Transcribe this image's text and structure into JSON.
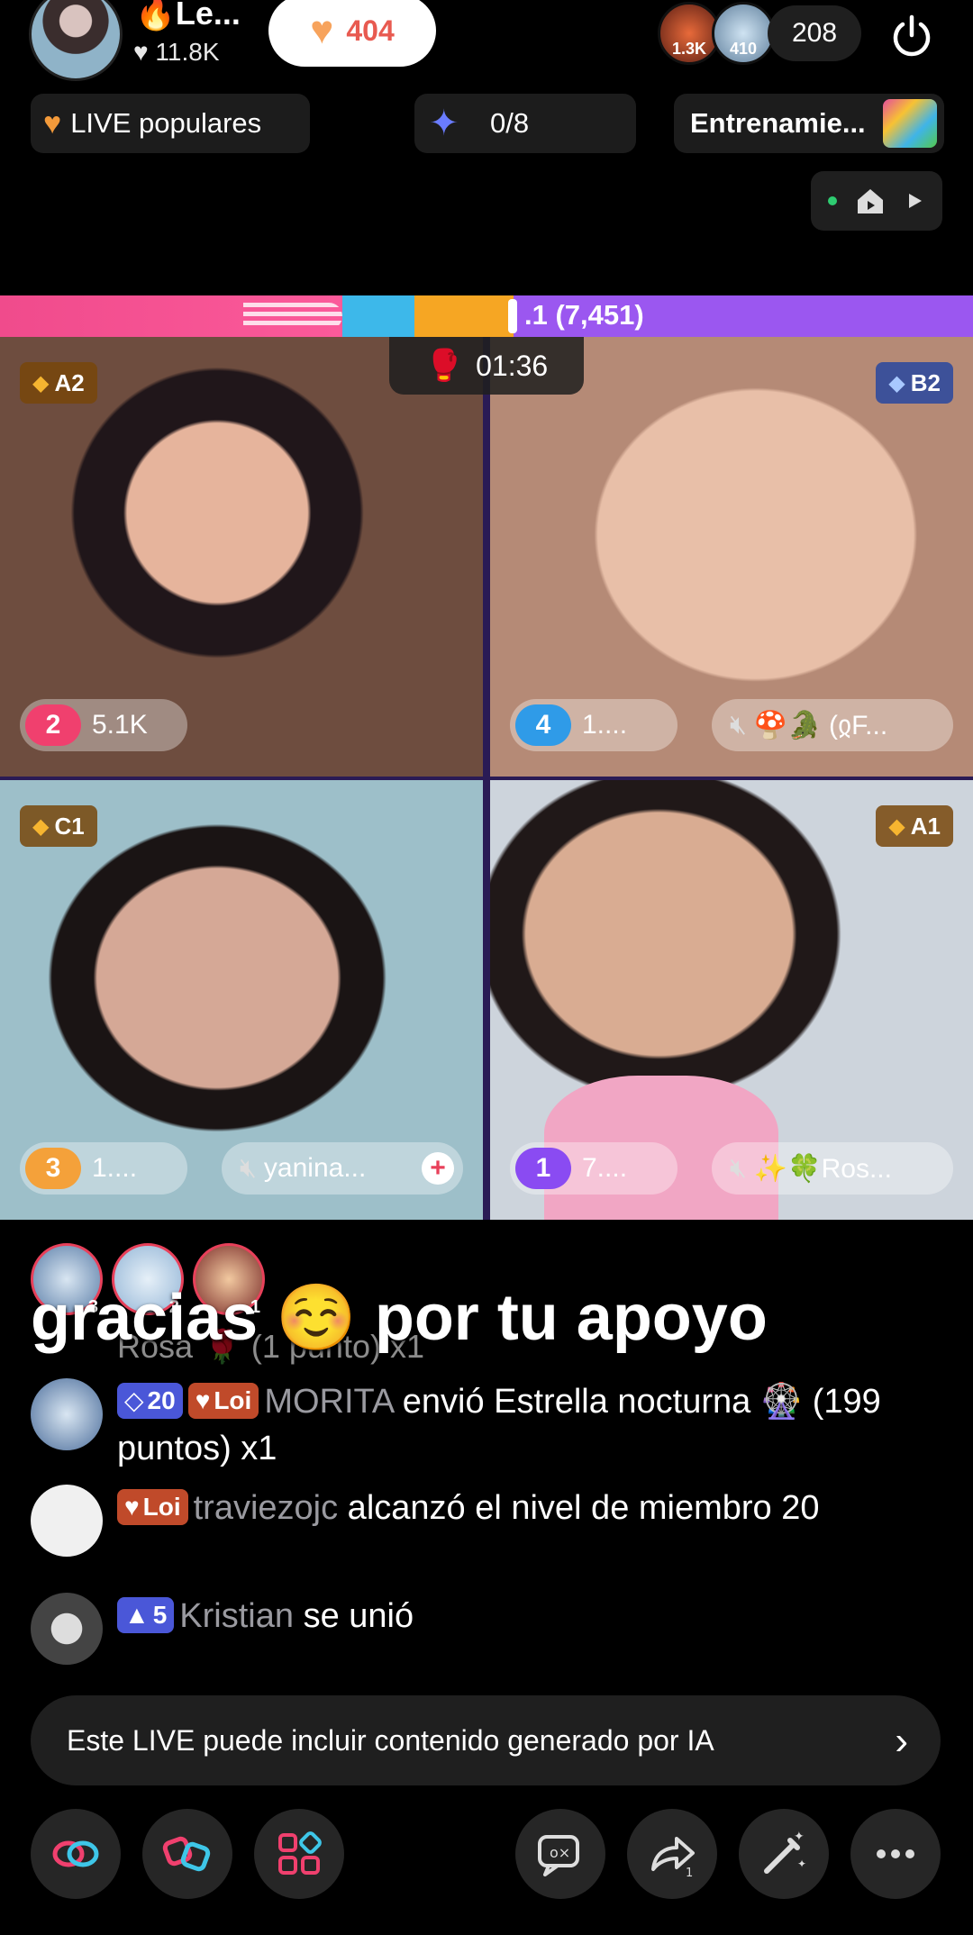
{
  "header": {
    "host_name": "🔥Le...",
    "host_likes": "♥ 11.8K",
    "follow_count": "404",
    "viewers": [
      {
        "label": "1.3K"
      },
      {
        "label": "410"
      }
    ],
    "viewer_count": "208"
  },
  "chips": {
    "popular": "LIVE populares",
    "goal": "0/8",
    "training": "Entrenamie..."
  },
  "battle": {
    "score": ".1 (7,451)",
    "timer": "01:36"
  },
  "tiles": [
    {
      "rank": "A2",
      "position": "2",
      "score": "5.1K"
    },
    {
      "rank": "B2",
      "position": "4",
      "score": "1....",
      "name": "🍄🐊 (ჲF..."
    },
    {
      "rank": "C1",
      "position": "3",
      "score": "1....",
      "name": "yanina..."
    },
    {
      "rank": "A1",
      "position": "1",
      "score": "7....",
      "name": "✨🍀Ros..."
    }
  ],
  "chat": {
    "gifter_ranks": [
      "3",
      "2",
      "1"
    ],
    "overlay": "gracias ☺️ por tu apoyo",
    "prev_message": "Rosa 🌹 (1 punto) x1",
    "messages": [
      {
        "level": "20",
        "fan": "Loi",
        "user": "MORITA",
        "text": " envió Estrella nocturna 🎡 (199 puntos) x1"
      },
      {
        "fan": "Loi",
        "user": "traviezojc",
        "text": " alcanzó el nivel de miembro 20"
      },
      {
        "level": "5",
        "user": "Kristian",
        "text": " se unió"
      }
    ]
  },
  "notice": {
    "text": "Este LIVE puede incluir contenido generado por IA"
  },
  "colors": {
    "accent_pink": "#f0406e",
    "follow_red": "#e85a50",
    "level_badge": "#4a57d8",
    "fan_badge": "#c04a2a"
  },
  "icons": [
    "power-icon",
    "heart-icon",
    "diamond-icon",
    "boxing-glove-icon",
    "mute-icon",
    "chevron-right-icon",
    "link-icon",
    "multi-guest-icon",
    "apps-icon",
    "comment-icon",
    "share-icon",
    "magic-wand-icon",
    "more-icon"
  ]
}
